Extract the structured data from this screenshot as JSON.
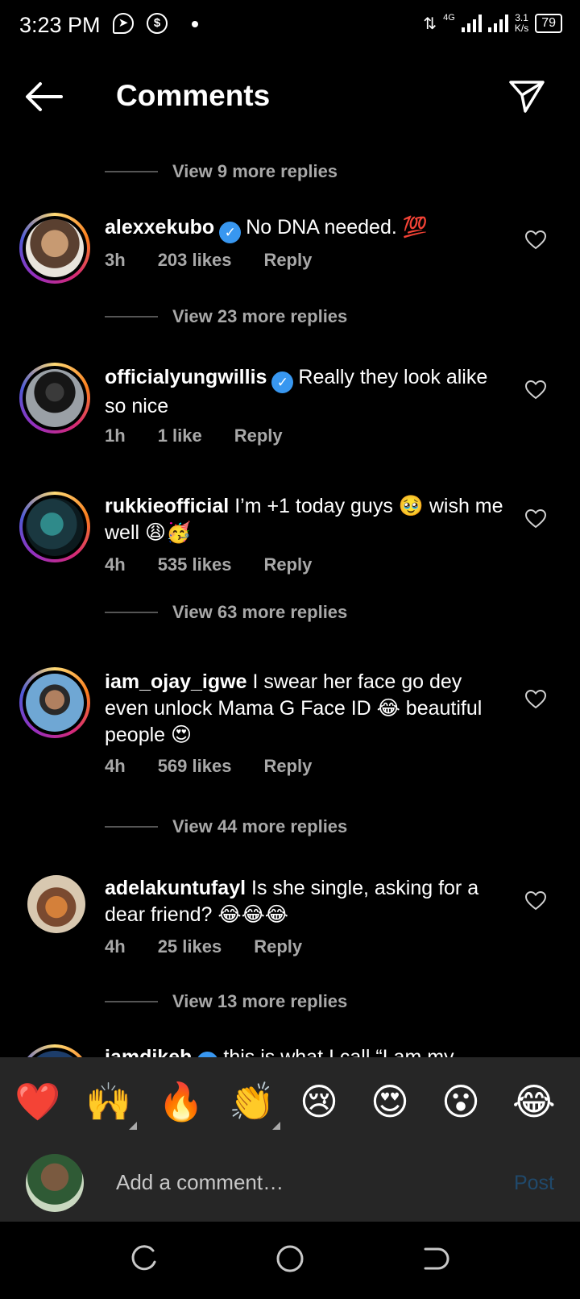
{
  "status": {
    "time": "3:23 PM",
    "network": "4G",
    "speed_value": "3.1",
    "speed_unit": "K/s",
    "battery": "79"
  },
  "header": {
    "title": "Comments",
    "back_icon": "arrow-left-icon",
    "send_icon": "paper-plane-icon"
  },
  "view_more": [
    "View 9 more replies",
    "View 23 more replies",
    "View 63 more replies",
    "View 44 more replies",
    "View 13 more replies"
  ],
  "comments": [
    {
      "username": "alexxekubo",
      "verified": true,
      "text": "No DNA needed. 💯",
      "time": "3h",
      "likes": "203 likes",
      "reply": "Reply"
    },
    {
      "username": "officialyungwillis",
      "verified": true,
      "text": "Really they look alike so nice",
      "time": "1h",
      "likes": "1 like",
      "reply": "Reply"
    },
    {
      "username": "rukkieofficial",
      "verified": false,
      "text": "I’m +1 today guys 🥹 wish me well 😩🥳",
      "time": "4h",
      "likes": "535 likes",
      "reply": "Reply"
    },
    {
      "username": "iam_ojay_igwe",
      "verified": false,
      "text": "I swear her face go dey even unlock Mama G Face ID 😂 beautiful people 😍",
      "time": "4h",
      "likes": "569 likes",
      "reply": "Reply"
    },
    {
      "username": "adelakuntufayl",
      "verified": false,
      "text": "Is she single, asking for a dear friend? 😂😂😂",
      "time": "4h",
      "likes": "25 likes",
      "reply": "Reply"
    },
    {
      "username": "iamdikeh",
      "verified": true,
      "text": "this is what I call “I am my",
      "time": "",
      "likes": "",
      "reply": ""
    }
  ],
  "reactions": [
    "❤️",
    "🙌",
    "🔥",
    "👏",
    "😢",
    "😍",
    "😮",
    "😂"
  ],
  "composer": {
    "placeholder": "Add a comment…",
    "post_label": "Post"
  },
  "colors": {
    "background": "#000000",
    "secondary_text": "#a8a8a8",
    "verified": "#3897f0",
    "panel": "#262626",
    "post_disabled": "#20496b"
  }
}
